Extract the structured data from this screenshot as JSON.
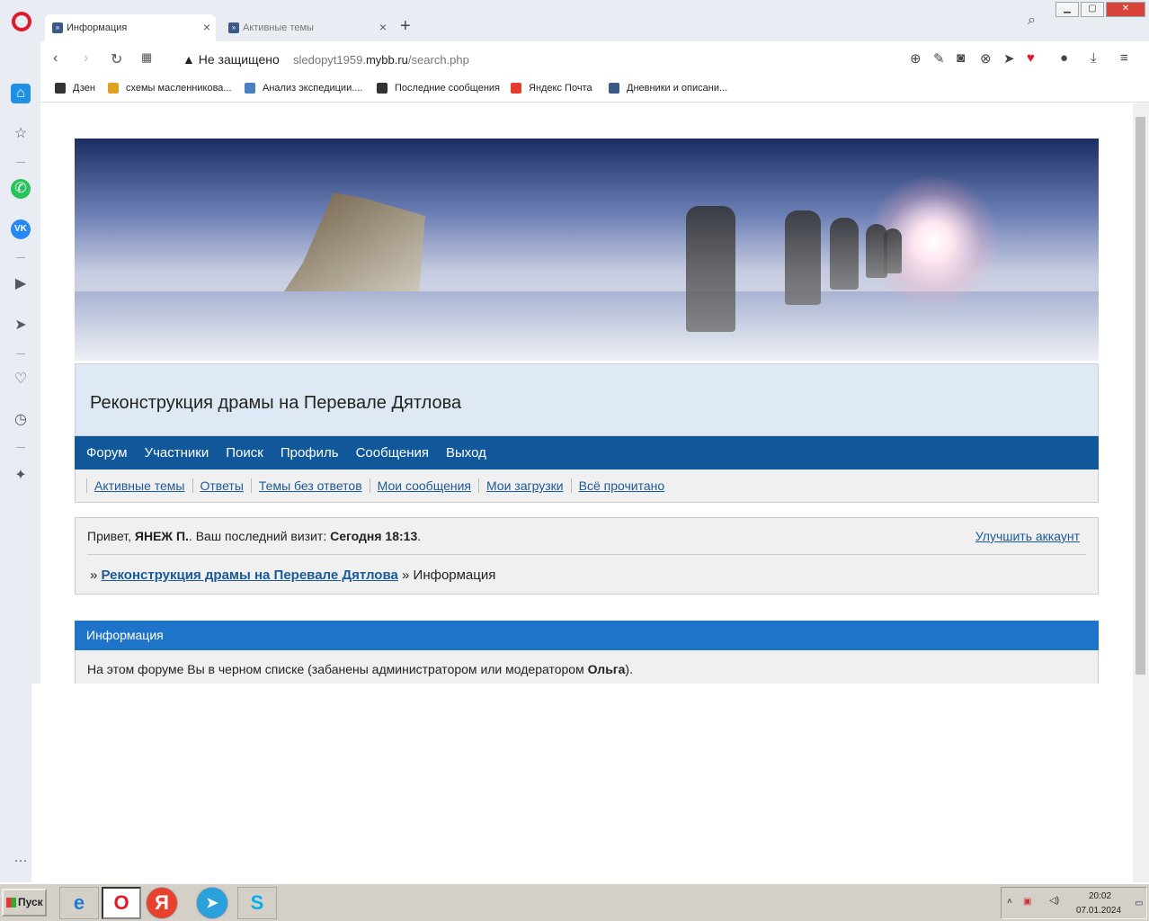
{
  "browser": {
    "tabs": [
      {
        "label": "Информация",
        "active": true
      },
      {
        "label": "Активные темы",
        "active": false
      }
    ],
    "security_label": "Не защищено",
    "url_prefix": "sledopyt1959.",
    "url_domain": "mybb.ru",
    "url_path": "/search.php",
    "bookmarks": [
      {
        "label": "Дзен",
        "color": "#333333"
      },
      {
        "label": "схемы масленникова...",
        "color": "#e0a020"
      },
      {
        "label": "Анализ экспедиции....",
        "color": "#4a7fc1"
      },
      {
        "label": "Последние сообщения",
        "color": "#333333"
      },
      {
        "label": "Яндекс Почта",
        "color": "#e63c2e"
      },
      {
        "label": "Дневники и описани...",
        "color": "#3b5a8a"
      }
    ]
  },
  "forum": {
    "title": "Реконструкция драмы на Перевале Дятлова",
    "main_nav": [
      "Форум",
      "Участники",
      "Поиск",
      "Профиль",
      "Сообщения",
      "Выход"
    ],
    "sub_nav": [
      "Активные темы",
      "Ответы",
      "Темы без ответов",
      "Мои сообщения",
      "Мои загрузки",
      "Всё прочитано"
    ],
    "welcome": {
      "greeting": "Привет, ",
      "user": "ЯНЕЖ П.",
      "last_visit_label": ". Ваш последний визит: ",
      "last_visit": "Сегодня 18:13",
      "upgrade": "Улучшить аккаунт"
    },
    "breadcrumb": {
      "link": "Реконструкция драмы на Перевале Дятлова",
      "current": "Информация"
    },
    "info": {
      "header": "Информация",
      "message_prefix": "На этом форуме Вы в черном списке (забанены администратором или модератором ",
      "moderator": "Ольга",
      "message_suffix": ")."
    }
  },
  "taskbar": {
    "start_label": "Пуск",
    "time": "20:02",
    "date": "07.01.2024"
  },
  "colors": {
    "nav_bg": "#10589a",
    "info_header_bg": "#1d74c8",
    "link": "#1b5a9a"
  }
}
